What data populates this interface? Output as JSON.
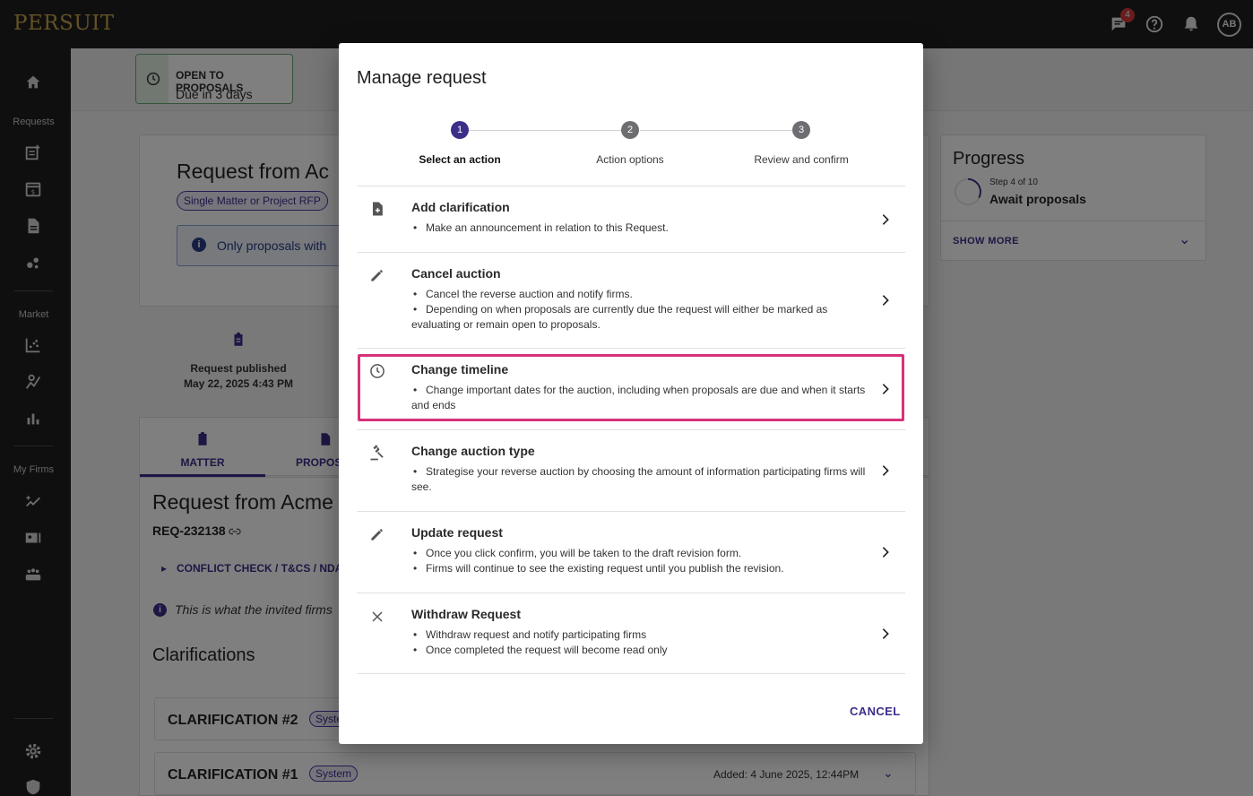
{
  "app": {
    "logo": "PERSUIT",
    "notification_count": "4",
    "avatar_initials": "AB"
  },
  "sidebar": {
    "requests_label": "Requests",
    "market_label": "Market",
    "myfirms_label": "My Firms"
  },
  "background": {
    "status_title": "OPEN TO PROPOSALS",
    "status_sub": "Due in 3 days",
    "request_title": "Request from Ac",
    "request_type_chip": "Single Matter or Project RFP",
    "info_text": "Only proposals with",
    "published_label": "Request published",
    "published_date": "May 22, 2025 4:43 PM",
    "tab_matter": "MATTER",
    "tab_proposals": "PROPOS",
    "matter_title": "Request from Acme",
    "req_id": "REQ-232138",
    "conflict_check": "CONFLICT CHECK / T&CS / NDA",
    "invited_note": "This is what the invited firms",
    "clarifications_heading": "Clarifications",
    "clarification_2": "CLARIFICATION #2",
    "clarification_2_chip": "Syste",
    "clarification_1": "CLARIFICATION #1",
    "clarification_1_chip": "System",
    "clarification_1_added": "Added: 4 June 2025, 12:44PM",
    "progress_title": "Progress",
    "progress_step": "Step 4 of 10",
    "progress_status": "Await proposals",
    "show_more": "SHOW MORE"
  },
  "modal": {
    "title": "Manage request",
    "steps": [
      {
        "number": "1",
        "label": "Select an action"
      },
      {
        "number": "2",
        "label": "Action options"
      },
      {
        "number": "3",
        "label": "Review and confirm"
      }
    ],
    "options": [
      {
        "title": "Add clarification",
        "bullets": [
          "Make an announcement in relation to this Request."
        ],
        "icon": "add-document-icon"
      },
      {
        "title": "Cancel auction",
        "bullets": [
          "Cancel the reverse auction and notify firms.",
          "Depending on when proposals are currently due the request will either be marked as evaluating or remain open to proposals."
        ],
        "icon": "pencil-icon"
      },
      {
        "title": "Change timeline",
        "bullets": [
          "Change important dates for the auction, including when proposals are due and when it starts and ends"
        ],
        "icon": "clock-icon"
      },
      {
        "title": "Change auction type",
        "bullets": [
          "Strategise your reverse auction by choosing the amount of information participating firms will see."
        ],
        "icon": "gavel-icon"
      },
      {
        "title": "Update request",
        "bullets": [
          "Once you click confirm, you will be taken to the draft revision form.",
          "Firms will continue to see the existing request until you publish the revision."
        ],
        "icon": "pencil-icon"
      },
      {
        "title": "Withdraw Request",
        "bullets": [
          "Withdraw request and notify participating firms",
          "Once completed the request will become read only"
        ],
        "icon": "close-icon"
      }
    ],
    "cancel_label": "CANCEL"
  },
  "colors": {
    "accent": "#3b2f8a",
    "highlight": "#d6317a",
    "sidebar_bg": "#1f1f21"
  }
}
